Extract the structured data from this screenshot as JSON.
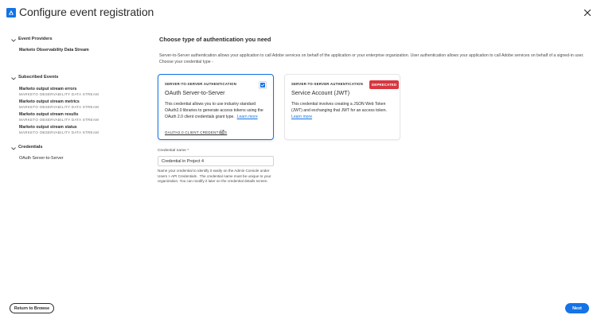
{
  "header": {
    "title": "Configure event registration",
    "accent_color": "#1473e6"
  },
  "sidebar": {
    "sections": [
      {
        "title": "Event Providers",
        "items": [
          "Marketo Observability Data Stream"
        ]
      },
      {
        "title": "Subscribed Events",
        "events": [
          {
            "name": "Marketo output stream errors",
            "provider": "MARKETO OBSERVABILITY DATA STREAM"
          },
          {
            "name": "Marketo output stream metrics",
            "provider": "MARKETO OBSERVABILITY DATA STREAM"
          },
          {
            "name": "Marketo output stream results",
            "provider": "MARKETO OBSERVABILITY DATA STREAM"
          },
          {
            "name": "Marketo output stream status",
            "provider": "MARKETO OBSERVABILITY DATA STREAM"
          }
        ]
      },
      {
        "title": "Credentials",
        "items": [
          "OAuth Server-to-Server"
        ]
      }
    ]
  },
  "main": {
    "title": "Choose type of authentication you need",
    "description": "Server-to-Server authentication allows your application to call Adobe services on behalf of the application or your enterprise organization. User authentication allows your application to call Adobe services on behalf of a signed-in user. Choose your credential type -",
    "cards": [
      {
        "eyebrow": "SERVER-TO-SERVER AUTHENTICATION",
        "title": "OAuth Server-to-Server",
        "body": "This credential allows you to use industry standard OAuth2.0 libraries to generate access tokens using the OAuth 2.0 client credentials grant type.",
        "link": "Learn more",
        "footer_link": "OAUTH2.0 CLIENT CREDENTIALS",
        "selected": true
      },
      {
        "eyebrow": "SERVER-TO-SERVER AUTHENTICATION",
        "title": "Service Account (JWT)",
        "body": "This credential involves creating a JSON Web Token (JWT) and exchanging that JWT for an access token.",
        "link": "Learn more",
        "badge": "DEPRECATED",
        "badge_color": "#d7373f",
        "selected": false
      }
    ],
    "credential": {
      "label": "Credential name *",
      "value": "Credential in Project 4",
      "help": "Name your credential to identify it easily on the Admin Console under Users > API Credentials . The credential name must be unique to your organization. You can modify it later on the credential details screen."
    }
  },
  "footer": {
    "back_label": "Return to Browse",
    "next_label": "Next"
  },
  "icons": {
    "app": "event-registration-icon",
    "close": "close-icon",
    "chevron": "chevron-down-icon",
    "check": "checkmark-icon",
    "external": "external-link-icon"
  }
}
